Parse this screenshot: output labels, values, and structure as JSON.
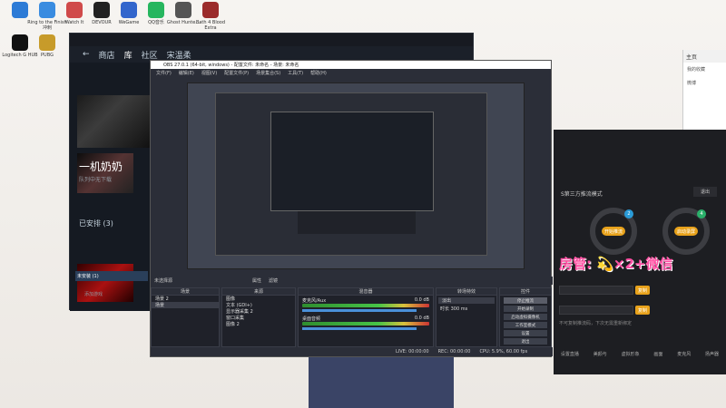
{
  "desktop": {
    "icons": [
      {
        "label": "",
        "color": "#2d7bd6"
      },
      {
        "label": "Ring to the Finish 冲刺",
        "color": "#3a8ce0"
      },
      {
        "label": "Watch It",
        "color": "#d04a4a"
      },
      {
        "label": "DEVOUR",
        "color": "#222222"
      },
      {
        "label": "WeGame",
        "color": "#3366cc"
      },
      {
        "label": "QQ音乐",
        "color": "#26b65e"
      },
      {
        "label": "Ghost Hunte...",
        "color": "#555555"
      },
      {
        "label": "Bath 4 Blood Extra",
        "color": "#9b2b2b"
      },
      {
        "label": "Logitech G HUB",
        "color": "#111111"
      },
      {
        "label": "PUBG",
        "color": "#c79b2a"
      }
    ]
  },
  "steam": {
    "nav": [
      "商店",
      "社区",
      "宋温柔"
    ],
    "sidebar_text": "一机奶奶",
    "download_text": "队列中无下载",
    "installed_label": "已安排 (3)",
    "bottom_label": "未安装 (1)",
    "add_game": "添加游戏"
  },
  "obs": {
    "title": "OBS 27.0.1 (64-bit, windows) - 配置文件: 未命名 - 场景: 未命名",
    "menu": [
      "文件(F)",
      "编辑(E)",
      "视图(V)",
      "配置文件(P)",
      "场景集合(S)",
      "工具(T)",
      "帮助(H)"
    ],
    "no_source": "未选择源",
    "props_btn": "属性",
    "filters_btn": "滤镜",
    "panels": {
      "scenes_title": "场景",
      "sources_title": "来源",
      "mixer_title": "混音器",
      "transitions_title": "转场特效",
      "controls_title": "控件"
    },
    "scenes": [
      "场景 2",
      "场景"
    ],
    "sources": [
      "图像",
      "文本 (GDI+)",
      "显示器采集 2",
      "窗口采集",
      "图像 2"
    ],
    "mixer": [
      {
        "name": "麦克风/Aux",
        "db": "0.0 dB"
      },
      {
        "name": "桌面音频",
        "db": "0.0 dB"
      }
    ],
    "transition": {
      "type": "淡出",
      "duration_label": "时长",
      "duration_value": "300 ms"
    },
    "controls": [
      "停止推流",
      "开始录制",
      "启动虚拟摄像机",
      "工作室模式",
      "设置",
      "退出"
    ],
    "status": {
      "live": "LIVE: 00:00:00",
      "rec": "REC: 00:00:00",
      "cpu": "CPU: 5.9%, 60.00 fps"
    }
  },
  "right_app": {
    "subtitle": "S第三方推流模式",
    "exit_btn": "退出",
    "pill_left": "开始推流",
    "pill_right": "启动录屏",
    "copy1": "复制",
    "copy2": "复制",
    "hint": "不可复制推流码，下次无需重新绑定",
    "watermark": "房管: 💫×2+微信",
    "bottom": [
      "设置直播",
      "美颜与",
      "虚拟形象",
      "画面",
      "麦克风",
      "扬声器"
    ],
    "badge_left": "2",
    "badge_right": "4"
  },
  "browser": {
    "title": "主页",
    "menu": [
      "我的收藏",
      "微博"
    ]
  }
}
